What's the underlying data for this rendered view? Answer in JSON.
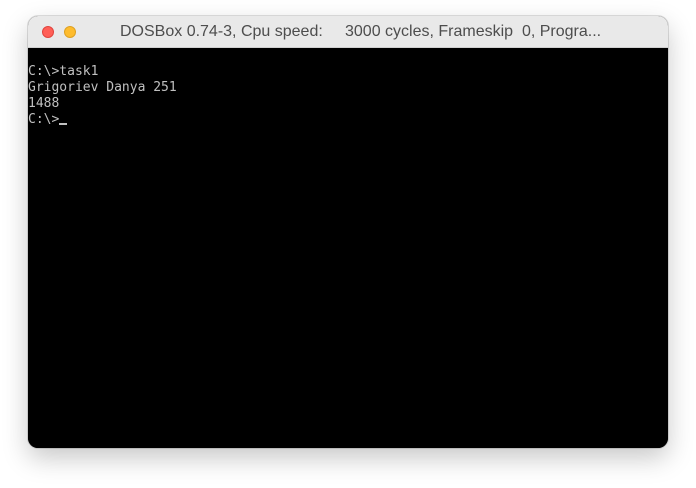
{
  "window": {
    "title": "DOSBox 0.74-3, Cpu speed:     3000 cycles, Frameskip  0, Progra..."
  },
  "console": {
    "lines": [
      "C:\\>task1",
      "Grigoriev Danya 251",
      "1488",
      "C:\\>"
    ],
    "text_color": "#c0c0c0",
    "background_color": "#000000"
  },
  "icons": {
    "close": "close-traffic-light-icon",
    "minimize": "minimize-traffic-light-icon"
  }
}
